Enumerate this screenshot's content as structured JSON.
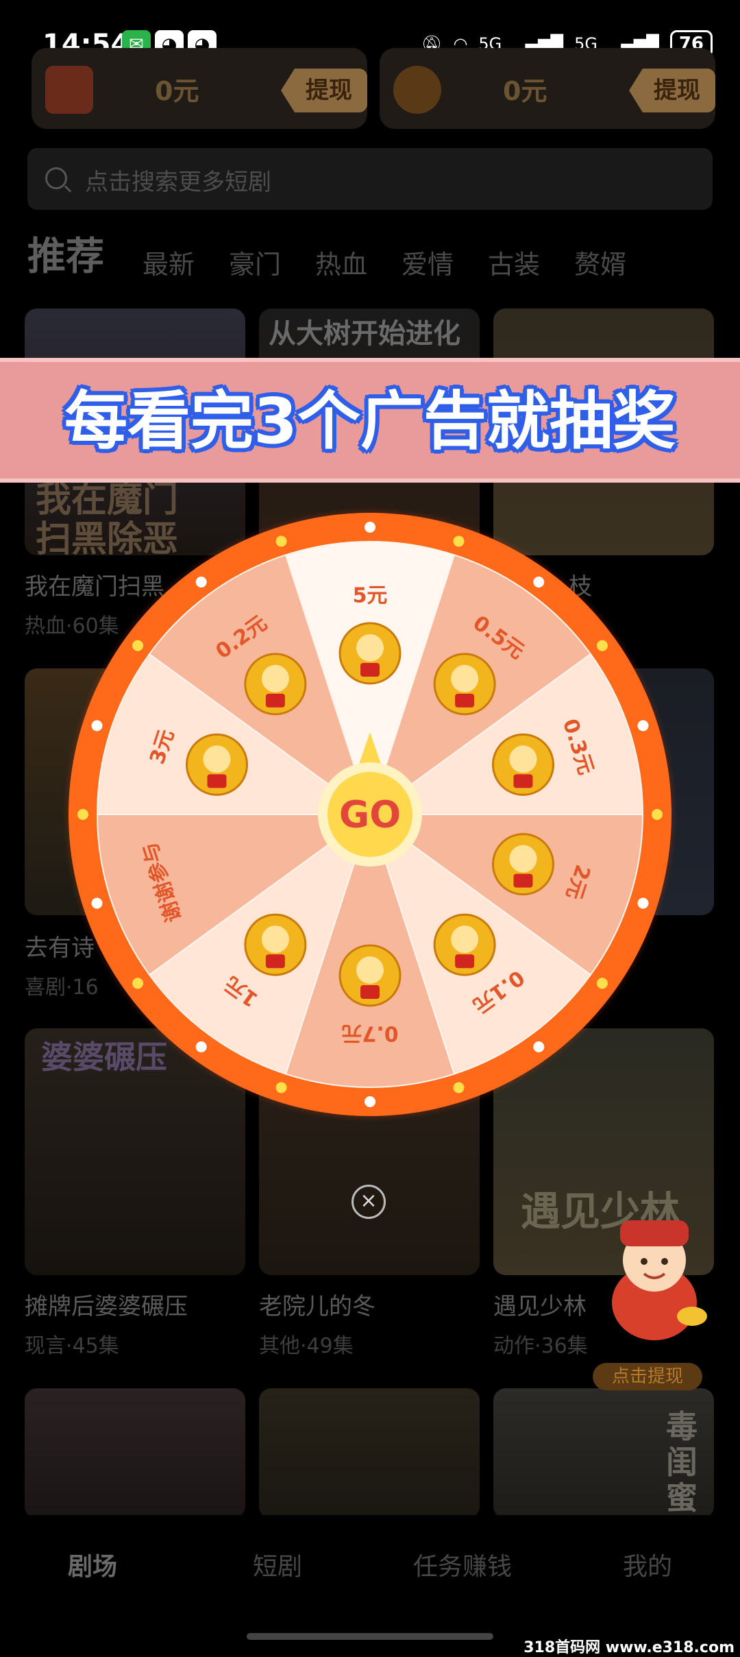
{
  "status_bar": {
    "time": "14:54",
    "battery": "76",
    "net1": "5G",
    "net2": "5G"
  },
  "wallets": [
    {
      "amount": "0元",
      "action": "提现"
    },
    {
      "amount": "0元",
      "action": "提现"
    }
  ],
  "search": {
    "placeholder": "点击搜索更多短剧"
  },
  "tabs": [
    "推荐",
    "最新",
    "豪门",
    "热血",
    "爱情",
    "古装",
    "赘婿"
  ],
  "dramas": [
    {
      "poster_text": "我在魔门\n扫黑除恶",
      "title": "我在魔门扫黑",
      "meta": "热血·60集"
    },
    {
      "poster_text": "从大树开始进化",
      "title": "",
      "meta": ""
    },
    {
      "poster_text": "",
      "title": "枝",
      "meta": ""
    },
    {
      "poster_text": "",
      "title": "去有诗",
      "meta": "喜剧·16"
    },
    {
      "poster_text": "",
      "title": "",
      "meta": ""
    },
    {
      "poster_text": "",
      "title": "",
      "meta": ""
    },
    {
      "poster_text": "婆婆碾压",
      "title": "摊牌后婆婆碾压",
      "meta": "现言·45集"
    },
    {
      "poster_text": "",
      "title": "老院儿的冬",
      "meta": "其他·49集"
    },
    {
      "poster_text": "遇见少林",
      "title": "遇见少林",
      "meta": "动作·36集"
    },
    {
      "poster_text": "",
      "title": "",
      "meta": ""
    },
    {
      "poster_text": "",
      "title": "",
      "meta": ""
    },
    {
      "poster_text": "毒闺蜜",
      "title": "",
      "meta": ""
    }
  ],
  "overlay": {
    "banner": "每看完3个广告就抽奖",
    "go_label": "GO",
    "prizes": [
      "5元",
      "0.5元",
      "0.3元",
      "2元",
      "0.1元",
      "0.7元",
      "1元",
      "谢谢参与",
      "3元",
      "0.2元"
    ],
    "close_label": "×",
    "withdraw_badge": "点击提现"
  },
  "bottom_nav": [
    "剧场",
    "短剧",
    "任务赚钱",
    "我的"
  ],
  "watermark": "318首码网 www.e318.com",
  "colors": {
    "wheel_rim": "#ff6a1a",
    "slice_light": "#ffe6d6",
    "slice_mid": "#f7b79a",
    "slice_white": "#fff7f0",
    "go": "#ffd84d"
  }
}
